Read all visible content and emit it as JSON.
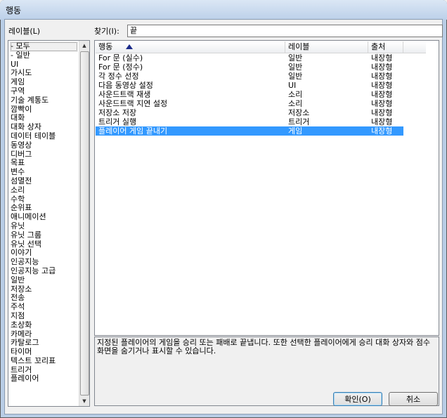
{
  "window": {
    "title": "행동"
  },
  "category_panel": {
    "label": "레이블(L)",
    "items": [
      "- 모두",
      "- 일반",
      "UI",
      "가시도",
      "게임",
      "구역",
      "기술 계통도",
      "깜빡이",
      "대화",
      "대화 상자",
      "데이터 테이블",
      "동영상",
      "디버그",
      "목표",
      "변수",
      "섬멸전",
      "소리",
      "수학",
      "순위표",
      "애니메이션",
      "유닛",
      "유닛 그룹",
      "유닛 선택",
      "이야기",
      "인공지능",
      "인공지능 고급",
      "일반",
      "저장소",
      "전송",
      "주석",
      "지점",
      "초상화",
      "카메라",
      "카탈로그",
      "타이머",
      "텍스트 꼬리표",
      "트리거",
      "플레이어"
    ],
    "selected_index": 0
  },
  "search": {
    "label": "찾기(I):",
    "value": "끝"
  },
  "table": {
    "columns": [
      "행동",
      "레이블",
      "출처"
    ],
    "sort_icon": "sort-ascending-icon",
    "rows": [
      [
        "For 문 (실수)",
        "일반",
        "내장형"
      ],
      [
        "For 문 (정수)",
        "일반",
        "내장형"
      ],
      [
        "각 정수 선정",
        "일반",
        "내장형"
      ],
      [
        "다음 동영상 설정",
        "UI",
        "내장형"
      ],
      [
        "사운드트랙 재생",
        "소리",
        "내장형"
      ],
      [
        "사운드트랙 지연 설정",
        "소리",
        "내장형"
      ],
      [
        "저장소 저장",
        "저장소",
        "내장형"
      ],
      [
        "트리거 실행",
        "트리거",
        "내장형"
      ],
      [
        "플레이어 게임 끝내기",
        "게임",
        "내장형"
      ]
    ],
    "selected_row": 8,
    "selection_color": "#3399ff"
  },
  "description": "지정된 플레이어의 게임을 승리 또는 패배로 끝냅니다. 또한 선택한 플레이어에게 승리 대화 상자와 점수 화면을 숨기거나 표시할 수 있습니다.",
  "buttons": {
    "ok": "확인(O)",
    "cancel": "취소"
  }
}
